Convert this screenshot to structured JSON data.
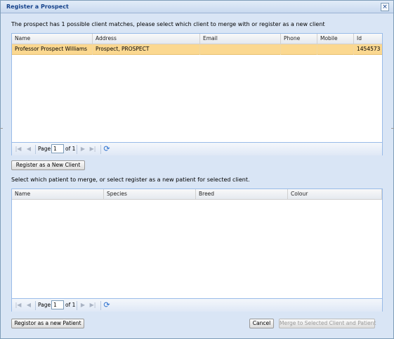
{
  "dialog": {
    "title": "Register a Prospect",
    "close_glyph": "×"
  },
  "client_section": {
    "message": "The prospect has 1 possible client matches, please select which client to merge with or register as a new client",
    "columns": [
      "Name",
      "Address",
      "Email",
      "Phone",
      "Mobile",
      "Id"
    ],
    "rows": [
      {
        "name": "Professor Prospect Williams",
        "address": "Prospect, PROSPECT",
        "email": "",
        "phone": "",
        "mobile": "",
        "id": "1454573",
        "selected": true
      }
    ],
    "pager": {
      "page_label": "Page",
      "page_value": "1",
      "of_label": "of 1"
    },
    "register_new_client_label": "Register as a New Client"
  },
  "patient_section": {
    "message": "Select which patient to merge, or select register as a new patient for selected client.",
    "columns": [
      "Name",
      "Species",
      "Breed",
      "Colour"
    ],
    "rows": [],
    "pager": {
      "page_label": "Page",
      "page_value": "1",
      "of_label": "of 1"
    }
  },
  "footer": {
    "register_new_patient_label": "Registor as a new Patient",
    "cancel_label": "Cancel",
    "merge_label": "Merge to Selected Client and Patient"
  },
  "colors": {
    "selection": "#fbd890",
    "title_text": "#15428b",
    "dialog_bg": "#d9e5f5",
    "refresh_icon": "#2a6fce"
  },
  "icons": {
    "first_page": "first-page-icon",
    "prev_page": "prev-page-icon",
    "next_page": "next-page-icon",
    "last_page": "last-page-icon",
    "refresh": "refresh-icon",
    "close": "close-icon"
  }
}
